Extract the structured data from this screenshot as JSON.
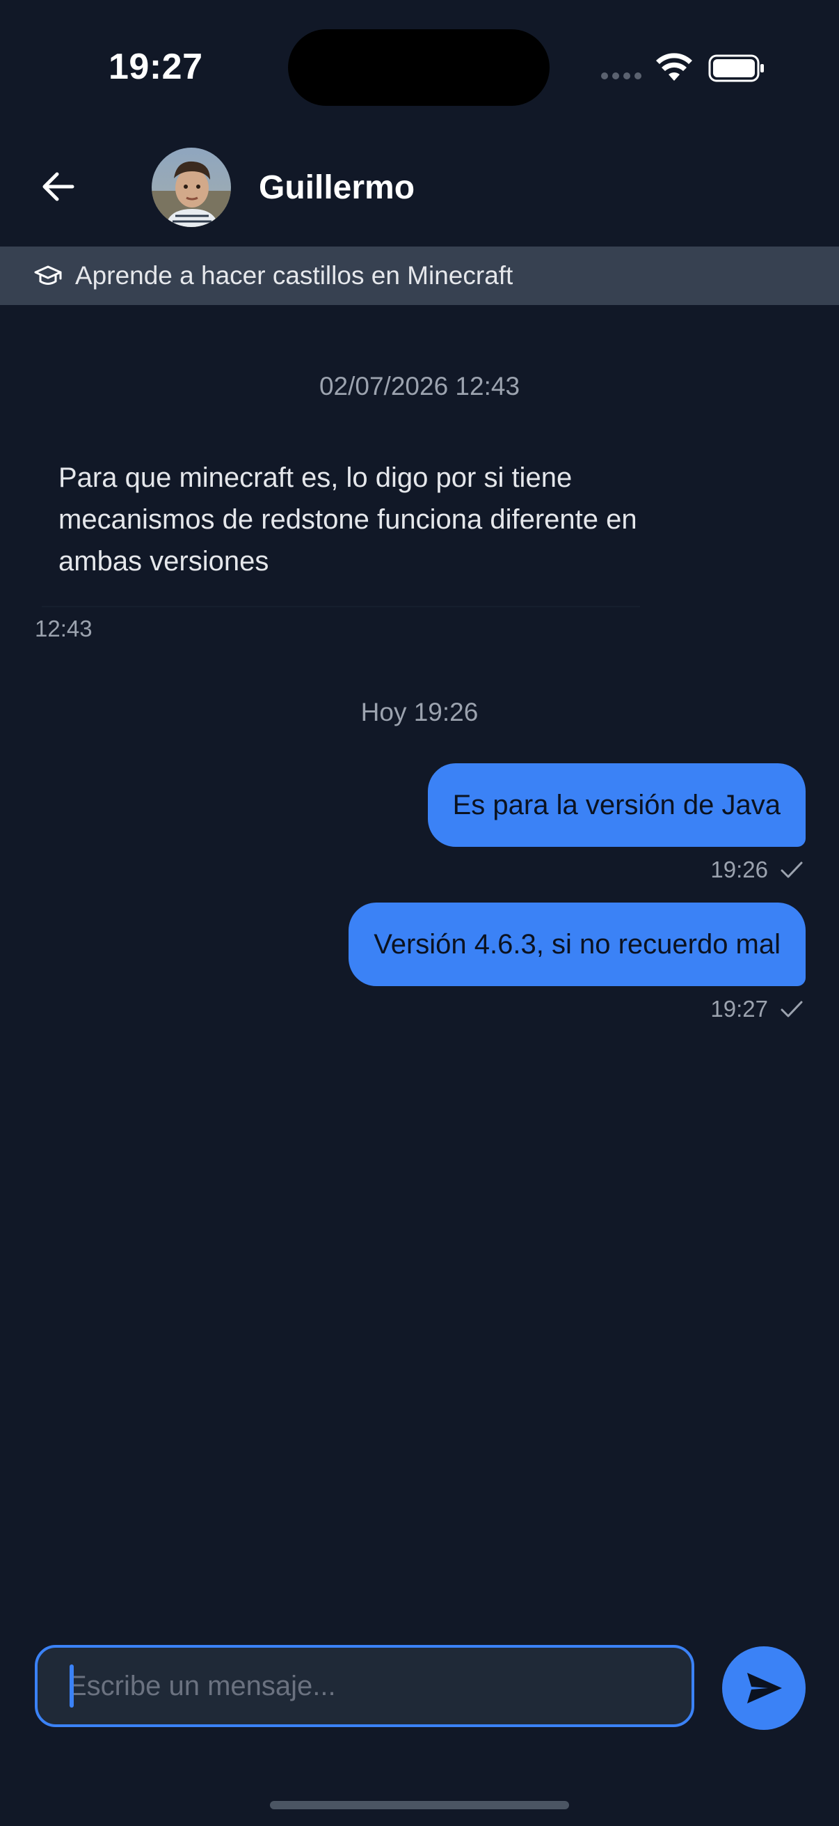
{
  "status_bar": {
    "time": "19:27"
  },
  "header": {
    "contact_name": "Guillermo",
    "back_icon": "arrow-left-icon",
    "avatar_icon": "avatar"
  },
  "course_banner": {
    "icon": "graduation-cap-icon",
    "label": "Aprende a hacer castillos en Minecraft",
    "background": "#374151"
  },
  "conversation": {
    "separators": [
      "02/07/2026 12:43",
      "Hoy 19:26"
    ],
    "messages": [
      {
        "direction": "incoming",
        "text": "Para que minecraft es, lo digo por si tiene mecanismos de redstone funciona diferente en ambas versiones",
        "time": "12:43"
      },
      {
        "direction": "outgoing",
        "text": "Es para la versión de Java",
        "time": "19:26",
        "status_icon": "check-icon"
      },
      {
        "direction": "outgoing",
        "text": "Versión 4.6.3, si no recuerdo mal",
        "time": "19:27",
        "status_icon": "check-icon"
      }
    ]
  },
  "composer": {
    "placeholder": "Escribe un mensaje...",
    "value": "",
    "send_icon": "send-icon"
  },
  "colors": {
    "background": "#111827",
    "accent": "#3b82f6",
    "muted_text": "#9ca3af",
    "input_background": "#1f2937"
  }
}
